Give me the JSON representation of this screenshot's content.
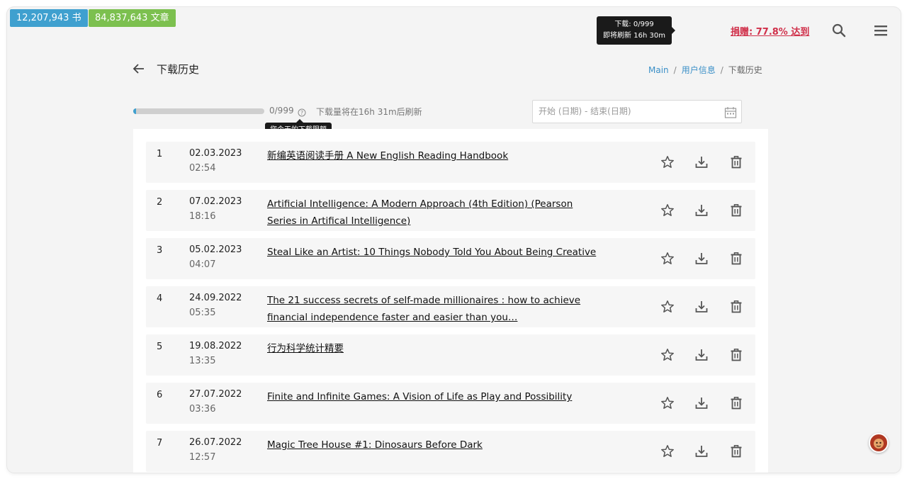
{
  "header": {
    "books_count": "12,207,943 书",
    "articles_count": "84,837,643 文章",
    "tooltip_line1": "下载: 0/999",
    "tooltip_line2": "即将刷新 16h 30m",
    "donate_text": "捐赠: 77.8% 达到"
  },
  "page": {
    "title": "下载历史",
    "breadcrumb": [
      "Main",
      "用户信息",
      "下载历史"
    ]
  },
  "quota": {
    "used_fraction": 0.02,
    "count_text": "0/999",
    "refresh_text": "下载量将在16h 31m后刷新",
    "tooltip": "您今天的下载限额"
  },
  "date_filter": {
    "placeholder": "开始 (日期) - 结束(日期)"
  },
  "downloads": [
    {
      "index": "1",
      "date": "02.03.2023",
      "time": "02:54",
      "title": "新编英语阅读手册 A New English Reading Handbook"
    },
    {
      "index": "2",
      "date": "07.02.2023",
      "time": "18:16",
      "title": "Artificial Intelligence: A Modern Approach (4th Edition) (Pearson Series in Artifical Intelligence)"
    },
    {
      "index": "3",
      "date": "05.02.2023",
      "time": "04:07",
      "title": "Steal Like an Artist: 10 Things Nobody Told You About Being Creative"
    },
    {
      "index": "4",
      "date": "24.09.2022",
      "time": "05:35",
      "title": "The 21 success secrets of self-made millionaires : how to achieve financial independence faster and easier than you…"
    },
    {
      "index": "5",
      "date": "19.08.2022",
      "time": "13:35",
      "title": "行为科学统计精要"
    },
    {
      "index": "6",
      "date": "27.07.2022",
      "time": "03:36",
      "title": "Finite and Infinite Games: A Vision of Life as Play and Possibility"
    },
    {
      "index": "7",
      "date": "26.07.2022",
      "time": "12:57",
      "title": "Magic Tree House #1: Dinosaurs Before Dark"
    }
  ],
  "colors": {
    "books_badge": "#3fa0cf",
    "articles_badge": "#7cc04f",
    "donate": "#d0304a",
    "link": "#3a8fc7"
  }
}
